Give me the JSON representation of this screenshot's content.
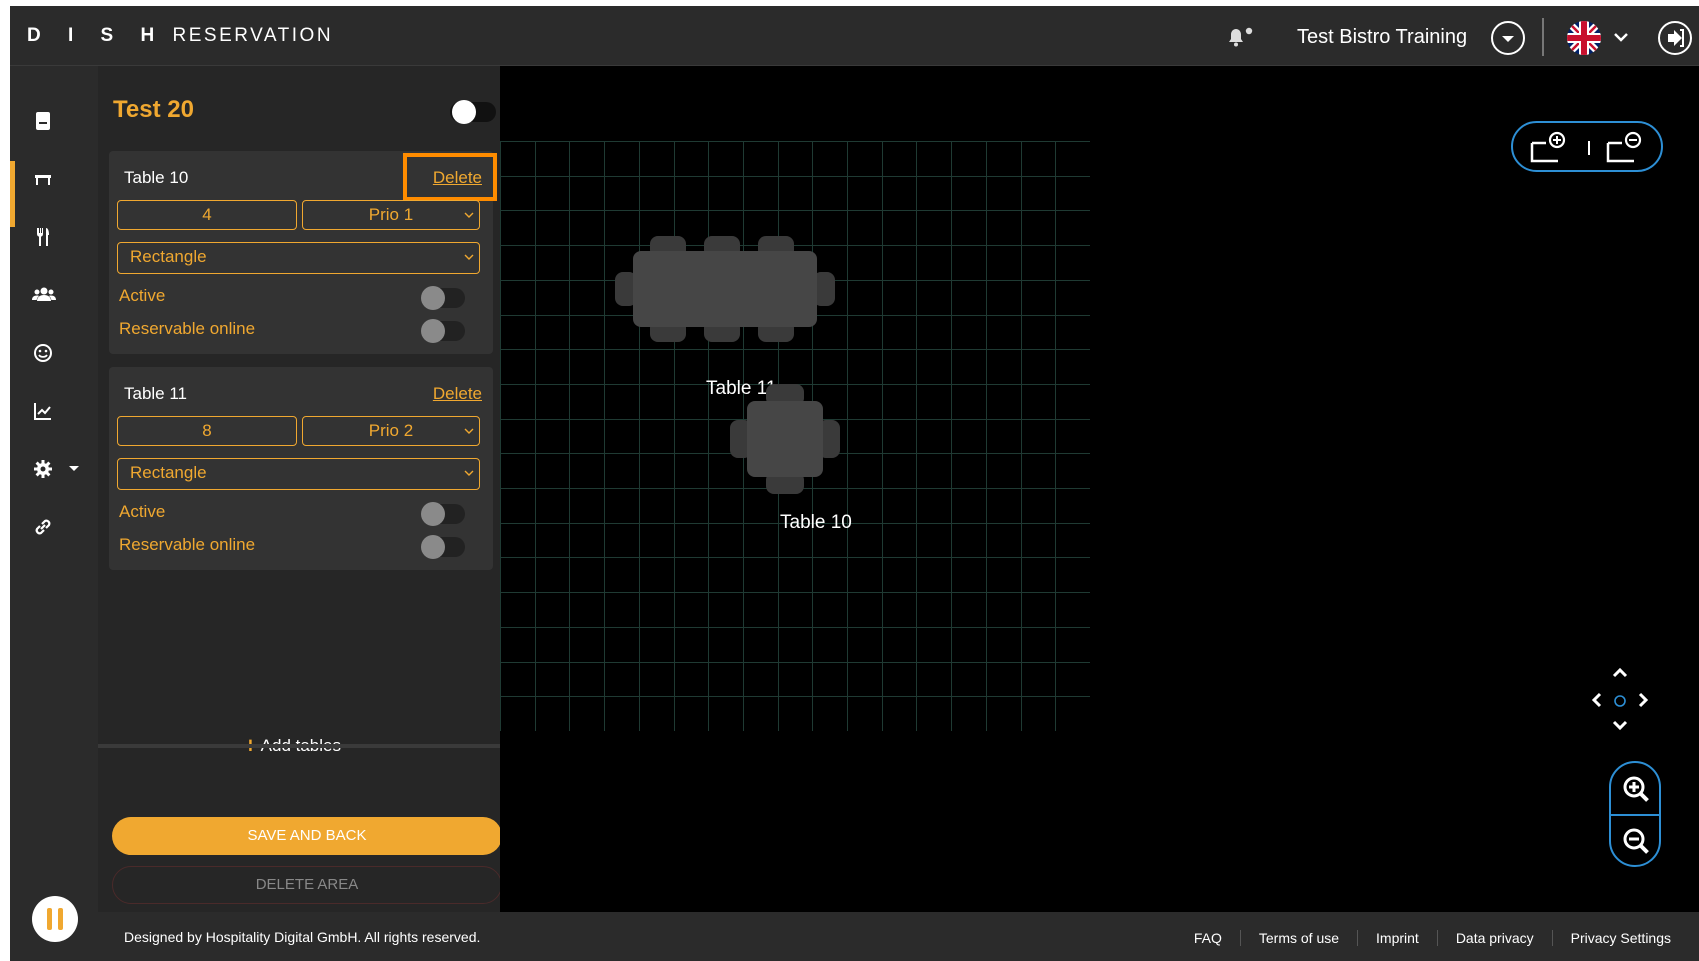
{
  "header": {
    "brand_bold": "D I S H",
    "brand_light": "RESERVATION",
    "venue": "Test Bistro Training"
  },
  "area": {
    "title": "Test 20"
  },
  "tables": [
    {
      "name": "Table 10",
      "delete_label": "Delete",
      "seats": "4",
      "priority": "Prio 1",
      "shape": "Rectangle",
      "active_label": "Active",
      "online_label": "Reservable online"
    },
    {
      "name": "Table 11",
      "delete_label": "Delete",
      "seats": "8",
      "priority": "Prio 2",
      "shape": "Rectangle",
      "active_label": "Active",
      "online_label": "Reservable online"
    }
  ],
  "actions": {
    "add_tables": "Add tables",
    "save_and_back": "SAVE AND BACK",
    "delete_area": "DELETE AREA"
  },
  "floorplan": {
    "label_table_11": "Table 11",
    "label_table_10": "Table 10"
  },
  "footer": {
    "copyright": "Designed by Hospitality Digital GmbH. All rights reserved.",
    "links": [
      "FAQ",
      "Terms of use",
      "Imprint",
      "Data privacy",
      "Privacy Settings"
    ]
  },
  "colors": {
    "accent": "#f0a830",
    "highlight": "#ff8c00",
    "control_blue": "#2d8fd5",
    "panel": "#262626",
    "bar": "#2b2b2b"
  }
}
